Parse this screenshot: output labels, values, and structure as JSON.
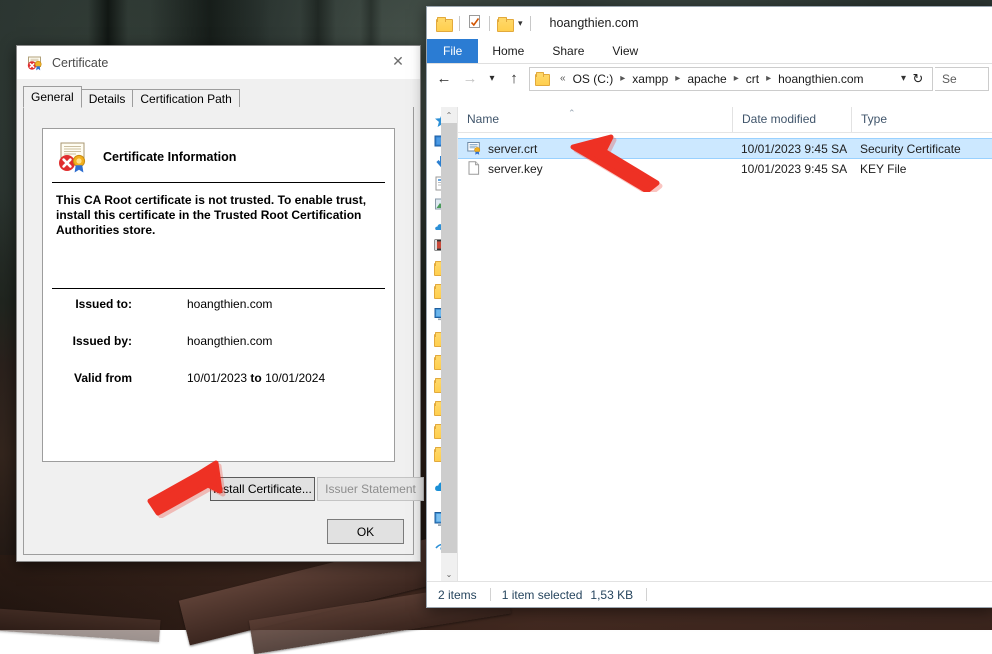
{
  "desktop": {
    "wallpaper_description": "dark forest floor wallpaper"
  },
  "certificate_dialog": {
    "title": "Certificate",
    "title_icon": "certificate-icon",
    "close_label": "✕",
    "tabs": [
      {
        "label": "General",
        "active": true
      },
      {
        "label": "Details",
        "active": false
      },
      {
        "label": "Certification Path",
        "active": false
      }
    ],
    "info_heading": "Certificate Information",
    "info_icon": "certificate-error-icon",
    "warning_text": "This CA Root certificate is not trusted. To enable trust, install this certificate in the Trusted Root Certification Authorities store.",
    "fields": [
      {
        "label": "Issued to:",
        "value": "hoangthien.com"
      },
      {
        "label": "Issued by:",
        "value": "hoangthien.com"
      }
    ],
    "validity": {
      "label": "Valid from",
      "from": "10/01/2023",
      "to_label": "to",
      "to": "10/01/2024"
    },
    "install_button": "Install Certificate...",
    "issuer_button": "Issuer Statement",
    "ok_button": "OK"
  },
  "explorer": {
    "title": "hoangthien.com",
    "quick_access": [
      "folder-icon",
      "properties-icon",
      "new-folder-icon"
    ],
    "qat_dropdown_icon": "chevron-down-icon",
    "ribbon_tabs": [
      {
        "label": "File",
        "active": true
      },
      {
        "label": "Home",
        "active": false
      },
      {
        "label": "Share",
        "active": false
      },
      {
        "label": "View",
        "active": false
      }
    ],
    "nav": {
      "back_icon": "arrow-left-icon",
      "forward_icon": "arrow-right-icon",
      "recent_icon": "chevron-down-icon",
      "up_icon": "arrow-up-icon"
    },
    "breadcrumb": {
      "folder_icon": "folder-icon",
      "overflow": "«",
      "items": [
        "OS (C:)",
        "xampp",
        "apache",
        "crt",
        "hoangthien.com"
      ],
      "dropdown_icon": "chevron-down-icon",
      "refresh_icon": "refresh-icon"
    },
    "search": {
      "placeholder": "Se",
      "value": ""
    },
    "columns": [
      {
        "label": "Name",
        "sorted": "asc"
      },
      {
        "label": "Date modified",
        "sorted": ""
      },
      {
        "label": "Type",
        "sorted": ""
      }
    ],
    "sort_indicator": "⌃",
    "files": [
      {
        "name": "server.crt",
        "date_modified": "10/01/2023 9:45 SA",
        "type": "Security Certificate",
        "icon": "certificate-file-icon",
        "selected": true
      },
      {
        "name": "server.key",
        "date_modified": "10/01/2023 9:45 SA",
        "type": "KEY File",
        "icon": "generic-file-icon",
        "selected": false
      }
    ],
    "status": {
      "item_count": "2 items",
      "selection": "1 item selected",
      "selection_size": "1,53 KB"
    },
    "sidebar_scrollbar": {
      "up_icon": "⌃",
      "down_icon": "⌄"
    }
  },
  "annotations": {
    "arrow_color": "#ee3124",
    "arrow_file": "red-arrow-pointing-to-server-crt",
    "arrow_install": "red-arrow-pointing-to-install-certificate"
  }
}
